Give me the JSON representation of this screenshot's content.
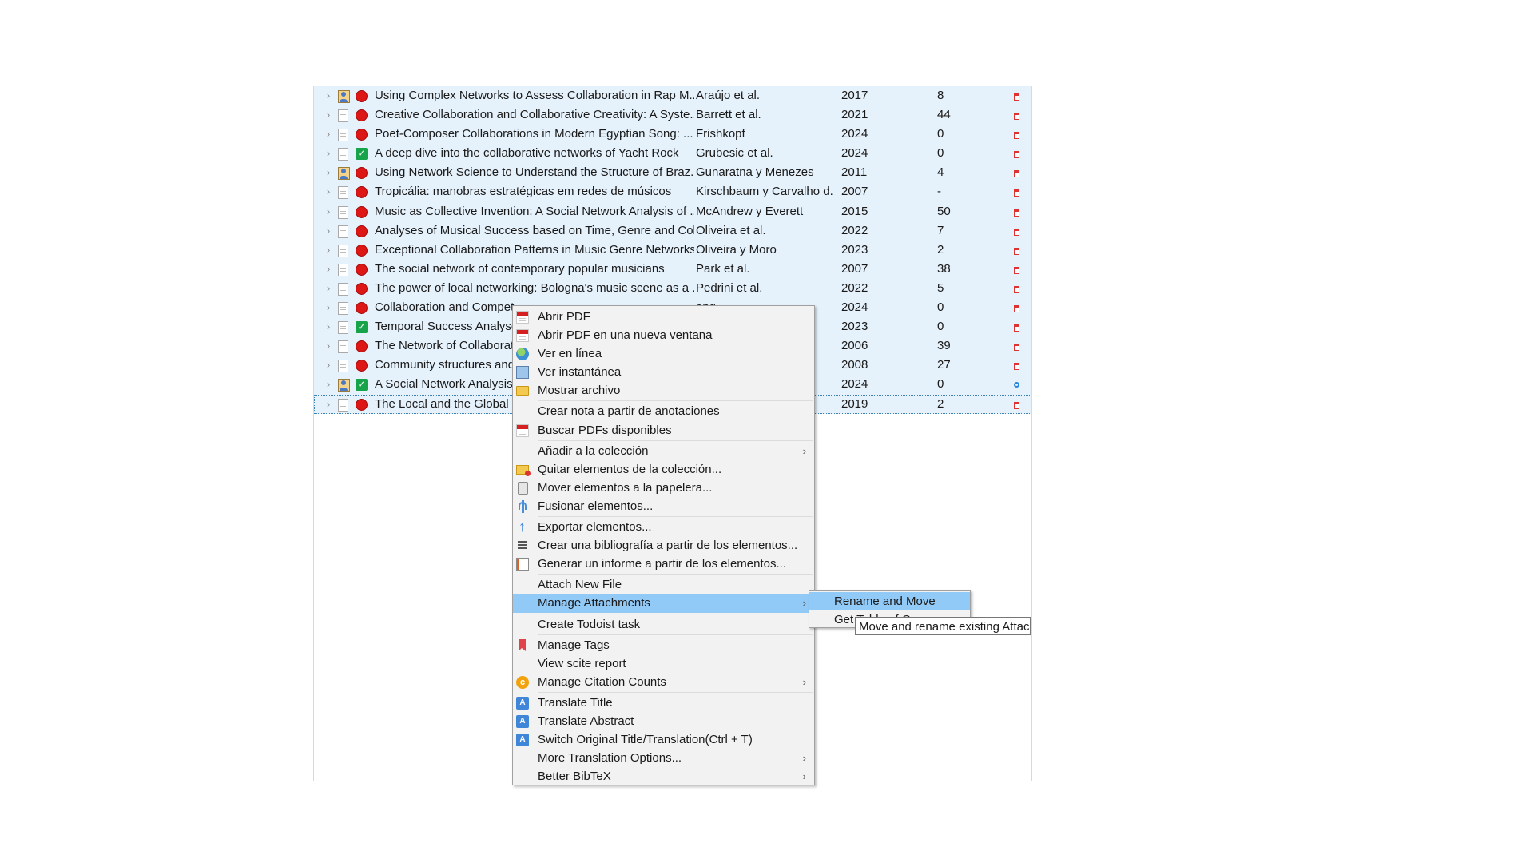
{
  "items": [
    {
      "type": "user",
      "status": "red",
      "title": "Using Complex Networks to Assess Collaboration in Rap M...",
      "creator": "Araújo et al.",
      "year": "2017",
      "citations": "8",
      "attachment": "pdf"
    },
    {
      "type": "doc",
      "status": "red",
      "title": "Creative Collaboration and Collaborative Creativity: A Syste...",
      "creator": "Barrett et al.",
      "year": "2021",
      "citations": "44",
      "attachment": "pdf"
    },
    {
      "type": "doc",
      "status": "red",
      "title": "Poet-Composer Collaborations in Modern Egyptian Song: ...",
      "creator": "Frishkopf",
      "year": "2024",
      "citations": "0",
      "attachment": "pdf"
    },
    {
      "type": "doc",
      "status": "green",
      "title": "A deep dive into the collaborative networks of Yacht Rock",
      "creator": "Grubesic et al.",
      "year": "2024",
      "citations": "0",
      "attachment": "pdf"
    },
    {
      "type": "user",
      "status": "red",
      "title": "Using Network Science to Understand the Structure of Braz...",
      "creator": "Gunaratna y Menezes",
      "year": "2011",
      "citations": "4",
      "attachment": "pdf"
    },
    {
      "type": "doc",
      "status": "red",
      "title": "Tropicália: manobras estratégicas em redes de músicos",
      "creator": "Kirschbaum y Carvalho d...",
      "year": "2007",
      "citations": "-",
      "attachment": "pdf"
    },
    {
      "type": "doc",
      "status": "red",
      "title": "Music as Collective Invention: A Social Network Analysis of ...",
      "creator": "McAndrew y Everett",
      "year": "2015",
      "citations": "50",
      "attachment": "pdf"
    },
    {
      "type": "doc",
      "status": "red",
      "title": "Analyses of Musical Success based on Time, Genre and Coll...",
      "creator": "Oliveira et al.",
      "year": "2022",
      "citations": "7",
      "attachment": "pdf"
    },
    {
      "type": "doc",
      "status": "red",
      "title": "Exceptional Collaboration Patterns in Music Genre Networks",
      "creator": "Oliveira y Moro",
      "year": "2023",
      "citations": "2",
      "attachment": "pdf"
    },
    {
      "type": "doc",
      "status": "red",
      "title": "The social network of contemporary popular musicians",
      "creator": "Park et al.",
      "year": "2007",
      "citations": "38",
      "attachment": "pdf"
    },
    {
      "type": "doc",
      "status": "red",
      "title": "The power of local networking: Bologna's music scene as a ...",
      "creator": "Pedrini et al.",
      "year": "2022",
      "citations": "5",
      "attachment": "pdf"
    },
    {
      "type": "doc",
      "status": "red",
      "title": "Collaboration and Compet",
      "creator": "ong",
      "year": "2024",
      "citations": "0",
      "attachment": "pdf"
    },
    {
      "type": "doc",
      "status": "green",
      "title": "Temporal Success Analyses",
      "creator": "",
      "year": "2023",
      "citations": "0",
      "attachment": "pdf"
    },
    {
      "type": "doc",
      "status": "red",
      "title": "The Network of Collaborat",
      "creator": "",
      "year": "2006",
      "citations": "39",
      "attachment": "pdf"
    },
    {
      "type": "doc",
      "status": "red",
      "title": "Community structures and",
      "creator": "",
      "year": "2008",
      "citations": "27",
      "attachment": "pdf"
    },
    {
      "type": "user",
      "status": "green",
      "title": "A Social Network Analysis",
      "creator": "",
      "year": "2024",
      "citations": "0",
      "attachment": "link"
    },
    {
      "type": "doc",
      "status": "red",
      "title": "The Local and the Global i",
      "creator": "",
      "year": "2019",
      "citations": "2",
      "attachment": "pdf",
      "focused": true
    }
  ],
  "context_menu": {
    "items": [
      {
        "kind": "item",
        "label": "Abrir PDF",
        "icon": "pdf-icon"
      },
      {
        "kind": "item",
        "label": "Abrir PDF en una nueva ventana",
        "icon": "pdf-icon"
      },
      {
        "kind": "item",
        "label": "Ver en línea",
        "icon": "globe-icon"
      },
      {
        "kind": "item",
        "label": "Ver instantánea",
        "icon": "snapshot-icon"
      },
      {
        "kind": "item",
        "label": "Mostrar archivo",
        "icon": "folder-icon"
      },
      {
        "kind": "sep"
      },
      {
        "kind": "item",
        "label": "Crear nota a partir de anotaciones",
        "icon": ""
      },
      {
        "kind": "item",
        "label": "Buscar PDFs disponibles",
        "icon": "pdf-icon"
      },
      {
        "kind": "sep"
      },
      {
        "kind": "item",
        "label": "Añadir a la colección",
        "icon": "",
        "submenu": true
      },
      {
        "kind": "item",
        "label": "Quitar elementos de la colección...",
        "icon": "folder-remove-icon"
      },
      {
        "kind": "item",
        "label": "Mover elementos a la papelera...",
        "icon": "trash-icon"
      },
      {
        "kind": "item",
        "label": "Fusionar elementos...",
        "icon": "merge-icon"
      },
      {
        "kind": "sep"
      },
      {
        "kind": "item",
        "label": "Exportar elementos...",
        "icon": "export-icon"
      },
      {
        "kind": "item",
        "label": "Crear una bibliografía a partir de los elementos...",
        "icon": "bibliography-icon"
      },
      {
        "kind": "item",
        "label": "Generar un informe a partir de los elementos...",
        "icon": "report-icon"
      },
      {
        "kind": "sep"
      },
      {
        "kind": "item",
        "label": "Attach New File",
        "icon": ""
      },
      {
        "kind": "item",
        "label": "Manage Attachments",
        "icon": "",
        "submenu": true,
        "highlighted": true
      },
      {
        "kind": "sep"
      },
      {
        "kind": "item",
        "label": "Create Todoist task",
        "icon": ""
      },
      {
        "kind": "sep"
      },
      {
        "kind": "item",
        "label": "Manage Tags",
        "icon": "tag-icon"
      },
      {
        "kind": "item",
        "label": "View scite report",
        "icon": ""
      },
      {
        "kind": "item",
        "label": "Manage Citation Counts",
        "icon": "citation-icon",
        "submenu": true
      },
      {
        "kind": "sep"
      },
      {
        "kind": "item",
        "label": "Translate Title",
        "icon": "translate-icon"
      },
      {
        "kind": "item",
        "label": "Translate Abstract",
        "icon": "translate-icon"
      },
      {
        "kind": "item",
        "label": "Switch Original Title/Translation(Ctrl + T)",
        "icon": "translate-icon"
      },
      {
        "kind": "item",
        "label": "More Translation Options...",
        "icon": "",
        "submenu": true
      },
      {
        "kind": "item",
        "label": "Better BibTeX",
        "icon": "",
        "submenu": true
      }
    ]
  },
  "submenu": {
    "items": [
      {
        "label": "Rename and Move",
        "highlighted": true
      },
      {
        "label": "Get Table of C..."
      }
    ]
  },
  "tooltip": "Move and rename existing Attachm",
  "colors": {
    "row_selected": "#e5f1fb",
    "menu_highlight": "#91c9f7",
    "status_red": "#dd1616",
    "status_green": "#17a34a"
  }
}
